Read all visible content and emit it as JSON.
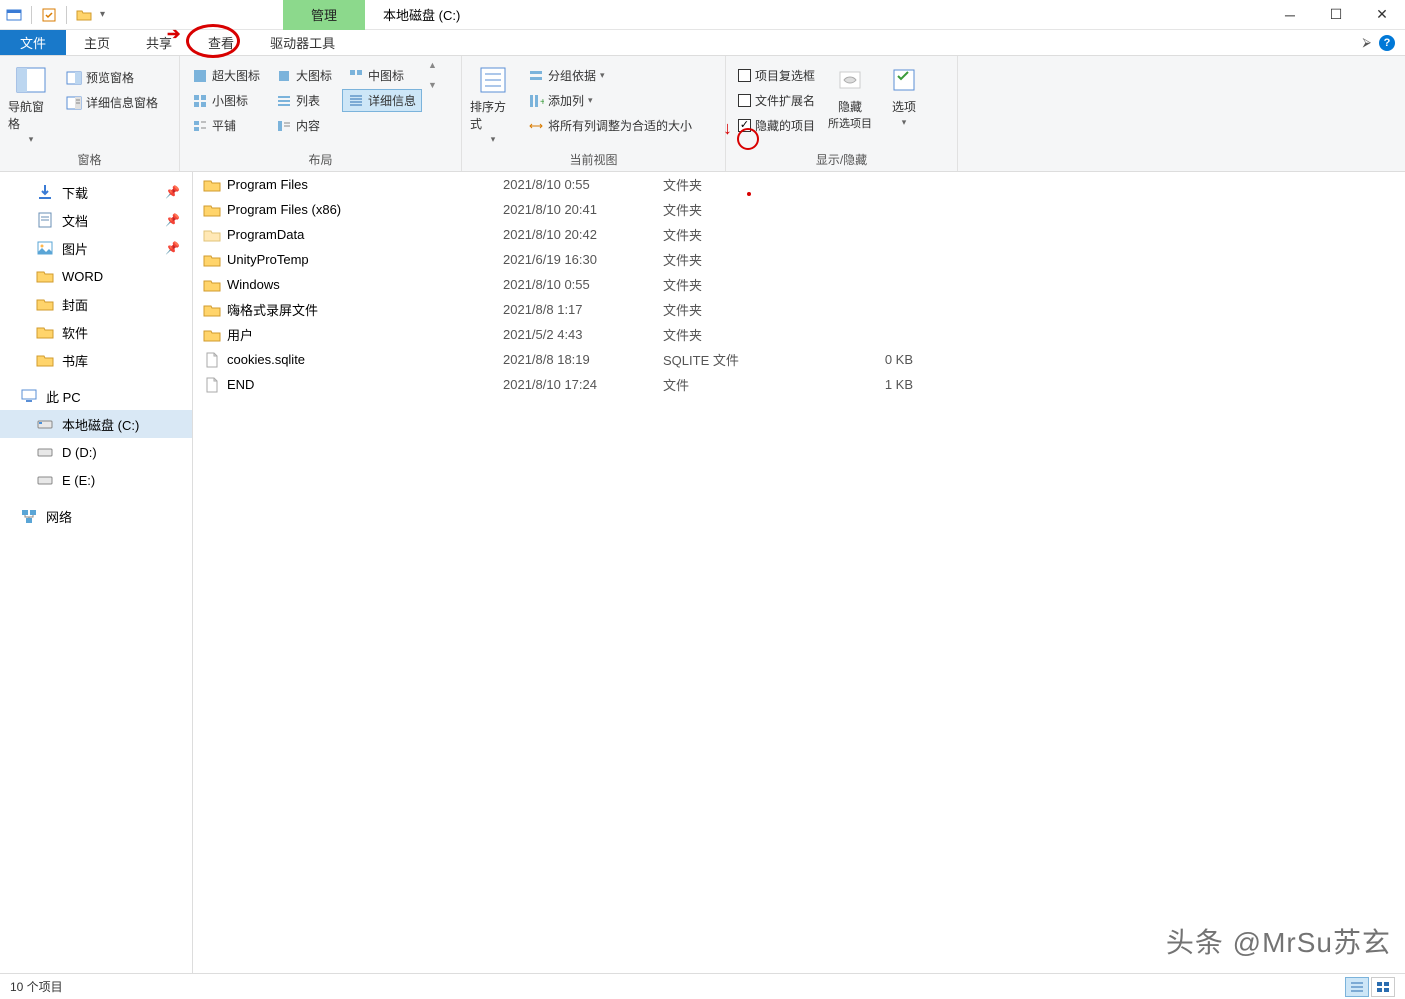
{
  "title": {
    "mgmt": "管理",
    "text": "本地磁盘 (C:)"
  },
  "tabs": {
    "file": "文件",
    "home": "主页",
    "share": "共享",
    "view": "查看",
    "drive_tools": "驱动器工具"
  },
  "ribbon": {
    "panes": {
      "nav": "导航窗格",
      "preview": "预览窗格",
      "details": "详细信息窗格",
      "label": "窗格"
    },
    "layout": {
      "xl_icons": "超大图标",
      "l_icons": "大图标",
      "m_icons": "中图标",
      "s_icons": "小图标",
      "list": "列表",
      "details": "详细信息",
      "tiles": "平铺",
      "content": "内容",
      "label": "布局"
    },
    "view": {
      "sort": "排序方式",
      "group": "分组依据",
      "add_cols": "添加列",
      "fit_cols": "将所有列调整为合适的大小",
      "label": "当前视图"
    },
    "showhide": {
      "checkboxes": "项目复选框",
      "extensions": "文件扩展名",
      "hidden": "隐藏的项目",
      "hide": "隐藏",
      "hide2": "所选项目",
      "options": "选项",
      "label": "显示/隐藏"
    }
  },
  "nav": {
    "downloads": "下载",
    "documents": "文档",
    "pictures": "图片",
    "word": "WORD",
    "cover": "封面",
    "software": "软件",
    "library": "书库",
    "pc": "此 PC",
    "c": "本地磁盘 (C:)",
    "d": "D (D:)",
    "e": "E (E:)",
    "network": "网络"
  },
  "files": [
    {
      "name": "Program Files",
      "date": "2021/8/10 0:55",
      "type": "文件夹",
      "size": "",
      "icon": "folder"
    },
    {
      "name": "Program Files (x86)",
      "date": "2021/8/10 20:41",
      "type": "文件夹",
      "size": "",
      "icon": "folder"
    },
    {
      "name": "ProgramData",
      "date": "2021/8/10 20:42",
      "type": "文件夹",
      "size": "",
      "icon": "folder-faded"
    },
    {
      "name": "UnityProTemp",
      "date": "2021/6/19 16:30",
      "type": "文件夹",
      "size": "",
      "icon": "folder"
    },
    {
      "name": "Windows",
      "date": "2021/8/10 0:55",
      "type": "文件夹",
      "size": "",
      "icon": "folder"
    },
    {
      "name": "嗨格式录屏文件",
      "date": "2021/8/8 1:17",
      "type": "文件夹",
      "size": "",
      "icon": "folder"
    },
    {
      "name": "用户",
      "date": "2021/5/2 4:43",
      "type": "文件夹",
      "size": "",
      "icon": "folder"
    },
    {
      "name": "cookies.sqlite",
      "date": "2021/8/8 18:19",
      "type": "SQLITE 文件",
      "size": "0 KB",
      "icon": "file"
    },
    {
      "name": "END",
      "date": "2021/8/10 17:24",
      "type": "文件",
      "size": "1 KB",
      "icon": "file"
    }
  ],
  "status": "10 个项目",
  "watermark": "头条 @MrSu苏玄"
}
